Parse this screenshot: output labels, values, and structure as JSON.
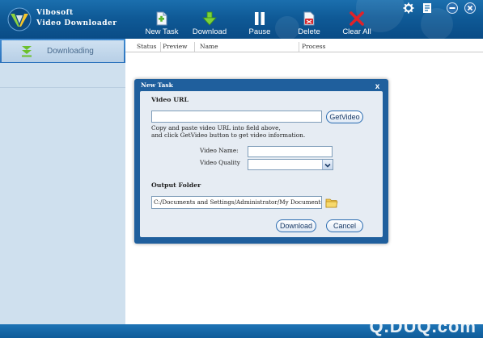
{
  "brand": {
    "line1": "Vibosoft",
    "line2": "Video Downloader"
  },
  "toolbar": [
    {
      "label": "New Task",
      "icon": "new-task-icon"
    },
    {
      "label": "Download",
      "icon": "download-arrow-icon"
    },
    {
      "label": "Pause",
      "icon": "pause-icon"
    },
    {
      "label": "Delete",
      "icon": "delete-icon"
    },
    {
      "label": "Clear All",
      "icon": "clear-all-icon"
    }
  ],
  "window_controls": [
    "gear-icon",
    "register-icon",
    "minimize-icon",
    "close-icon"
  ],
  "sidebar": {
    "items": [
      {
        "label": "Downloading",
        "icon": "download-arrow-icon"
      }
    ]
  },
  "table": {
    "columns": [
      "Status",
      "Preview",
      "Name",
      "Process"
    ]
  },
  "dialog": {
    "title": "New Task",
    "video_url_label": "Video URL",
    "url_value": "",
    "getvideo_label": "GetVideo",
    "hint_line1": "Copy and paste video URL into field above,",
    "hint_line2": "and click GetVideo button to get video information.",
    "video_name_label": "Video Name:",
    "video_name_value": "",
    "video_quality_label": "Video Quality",
    "video_quality_value": "",
    "output_folder_label": "Output Folder",
    "output_path": "C:/Documents and Settings/Administrator/My Documents",
    "download_label": "Download",
    "cancel_label": "Cancel"
  },
  "watermark": "Q.DUQ.com",
  "colors": {
    "header": "#0f5a97",
    "sidebar": "#cfe0ee",
    "dialog_frame": "#1f5f9d",
    "dialog_body": "#e6ecf3",
    "accent_green": "#6cc02c",
    "accent_red": "#d8262c"
  }
}
